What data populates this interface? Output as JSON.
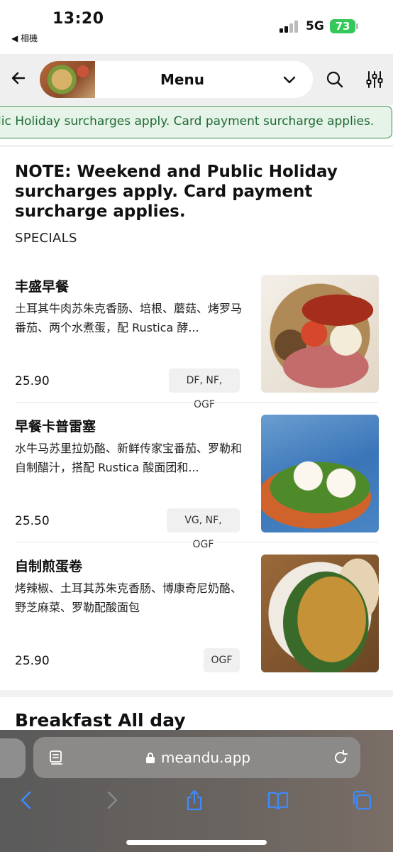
{
  "status_bar": {
    "time": "13:20",
    "back_app": "◀ 相機",
    "network": "5G",
    "battery": "73"
  },
  "header": {
    "menu_label": "Menu"
  },
  "banner": {
    "text": "lic Holiday surcharges apply. Card payment surcharge applies."
  },
  "note": "NOTE: Weekend and Public Holiday surcharges apply. Card payment surcharge applies.",
  "section_title": "SPECIALS",
  "items": [
    {
      "name": "丰盛早餐",
      "description": "土耳其牛肉苏朱克香肠、培根、蘑菇、烤罗马番茄、两个水煮蛋，配 Rustica 酵...",
      "price": "25.90",
      "tags": "DF, NF, OGF"
    },
    {
      "name": "早餐卡普雷塞",
      "description": "水牛马苏里拉奶酪、新鲜传家宝番茄、罗勒和自制醋汁，搭配 Rustica 酸面团和...",
      "price": "25.50",
      "tags": "VG, NF, OGF"
    },
    {
      "name": "自制煎蛋卷",
      "description": "烤辣椒、土耳其苏朱克香肠、博康奇尼奶酪、野芝麻菜、罗勒配酸面包",
      "price": "25.90",
      "tags": "OGF"
    }
  ],
  "next_section_title": "Breakfast All day",
  "browser": {
    "url": "meandu.app"
  },
  "colors": {
    "banner_bg": "#e6f3e8",
    "banner_border": "#3c8a4f",
    "banner_text": "#1e6a35",
    "battery": "#34c759",
    "toolbar_icon": "#3d8bff"
  },
  "icons": [
    "back-arrow-icon",
    "chevron-down-icon",
    "search-icon",
    "filter-icon",
    "reader-icon",
    "lock-icon",
    "reload-icon",
    "browser-back-icon",
    "browser-forward-icon",
    "share-icon",
    "bookmarks-icon",
    "tabs-icon"
  ]
}
